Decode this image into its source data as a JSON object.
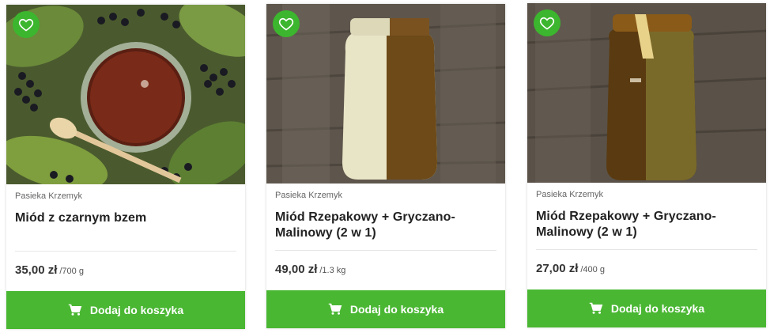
{
  "colors": {
    "accent": "#4ab733",
    "fav_bg": "#3cb62e"
  },
  "products": [
    {
      "producer": "Pasieka Krzemyk",
      "title": "Miód z czarnym bzem",
      "price": "35,00 zł",
      "unit": "/700 g",
      "button_label": "Dodaj do koszyka",
      "image_icon": "honey-elderberry-photo"
    },
    {
      "producer": "Pasieka Krzemyk",
      "title": "Miód Rzepakowy + Gryczano-Malinowy (2 w 1)",
      "price": "49,00 zł",
      "unit": "/1.3 kg",
      "button_label": "Dodaj do koszyka",
      "image_icon": "honey-jar-two-in-one-photo"
    },
    {
      "producer": "Pasieka Krzemyk",
      "title": "Miód Rzepakowy + Gryczano-Malinowy (2 w 1)",
      "price": "27,00 zł",
      "unit": "/400 g",
      "button_label": "Dodaj do koszyka",
      "image_icon": "honey-jar-two-in-one-photo"
    }
  ]
}
